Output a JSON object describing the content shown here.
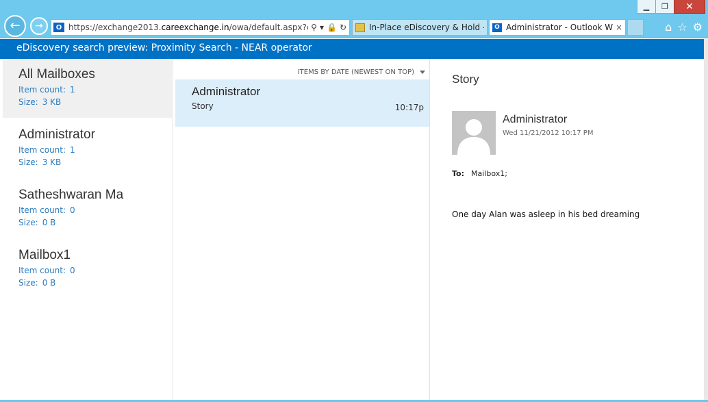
{
  "browser": {
    "url_prefix": "https://exchange2013.",
    "url_domain": "careexchange.in",
    "url_suffix": "/owa/default.aspx?cmd=c",
    "tabs": [
      {
        "label": "In-Place eDiscovery & Hold - ..."
      },
      {
        "label": "Administrator - Outlook We...",
        "close": "×"
      }
    ],
    "window": {
      "minimize": "▁",
      "restore": "❐",
      "close": "✕"
    }
  },
  "app": {
    "title": "eDiscovery search preview: Proximity Search - NEAR operator"
  },
  "mailboxes": [
    {
      "name": "All Mailboxes",
      "count_label": "Item count:",
      "count": "1",
      "size_label": "Size:",
      "size": "3 KB"
    },
    {
      "name": "Administrator",
      "count_label": "Item count:",
      "count": "1",
      "size_label": "Size:",
      "size": "3 KB"
    },
    {
      "name": "Satheshwaran Ma",
      "count_label": "Item count:",
      "count": "0",
      "size_label": "Size:",
      "size": "0 B"
    },
    {
      "name": "Mailbox1",
      "count_label": "Item count:",
      "count": "0",
      "size_label": "Size:",
      "size": "0 B"
    }
  ],
  "list": {
    "sort_label": "ITEMS BY DATE (NEWEST ON TOP)",
    "items": [
      {
        "from": "Administrator",
        "subject": "Story",
        "time": "10:17p"
      }
    ]
  },
  "reading": {
    "subject": "Story",
    "sender": "Administrator",
    "sent": "Wed 11/21/2012 10:17 PM",
    "to_label": "To:",
    "to": "Mailbox1;",
    "body": "One day Alan was asleep in his bed dreaming"
  }
}
